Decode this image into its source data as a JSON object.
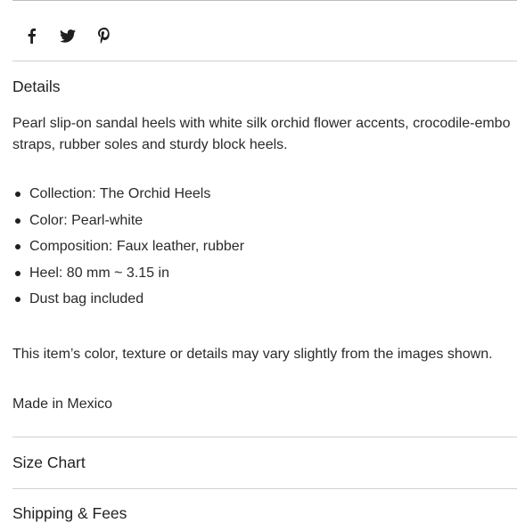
{
  "share": {
    "icons": [
      "facebook-icon",
      "twitter-icon",
      "pinterest-icon"
    ]
  },
  "details": {
    "title": "Details",
    "description_line1": "Pearl slip-on sandal heels with white silk orchid flower accents, crocodile-embo",
    "description_line2": "straps, rubber soles and sturdy block heels.",
    "bullets": [
      "Collection: The Orchid Heels",
      "Color: Pearl-white",
      "Composition: Faux leather, rubber",
      "Heel: 80 mm ~ 3.15 in",
      "Dust bag included"
    ],
    "disclaimer": "This item’s color, texture or details may vary slightly from the images shown.",
    "origin": "Made in Mexico"
  },
  "size_chart": {
    "title": "Size Chart"
  },
  "shipping": {
    "title": "Shipping & Fees"
  },
  "colors": {
    "text": "#1f1f1f",
    "rule": "#d0d0d0",
    "background": "#ffffff"
  }
}
